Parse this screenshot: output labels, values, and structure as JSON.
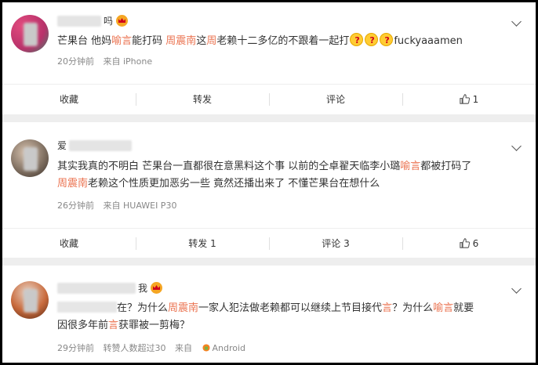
{
  "comments": [
    {
      "username_suffix": "吗",
      "content_segments": [
        {
          "text": "芒果台 他妈",
          "hl": false
        },
        {
          "text": "喻言",
          "hl": true
        },
        {
          "text": "能打码 ",
          "hl": false
        },
        {
          "text": "周震南",
          "hl": true
        },
        {
          "text": "这",
          "hl": false
        },
        {
          "text": "周",
          "hl": true
        },
        {
          "text": "老赖十二多亿的不跟着一起打",
          "hl": false
        }
      ],
      "content_tail": "fuckyaaamen",
      "emoji_count": 3,
      "time": "20分钟前",
      "source": "来自 iPhone",
      "actions": {
        "collect": "收藏",
        "forward": "转发",
        "comment": "评论",
        "like": "1"
      }
    },
    {
      "username_prefix": "爱",
      "line1_segments": [
        {
          "text": "其实我真的不明白 芒果台一直都很在意黑料这个事 以前的仝卓翟天临李小璐",
          "hl": false
        },
        {
          "text": "喻言",
          "hl": true
        },
        {
          "text": "都被打码了",
          "hl": false
        }
      ],
      "line2_segments": [
        {
          "text": "周震南",
          "hl": true
        },
        {
          "text": "老赖这个性质更加恶劣一些 竟然还播出来了 不懂芒果台在想什么",
          "hl": false
        }
      ],
      "time": "26分钟前",
      "source": "来自 HUAWEI P30",
      "actions": {
        "collect": "收藏",
        "forward": "转发 1",
        "comment": "评论 3",
        "like": "6"
      }
    },
    {
      "username_suffix": "我",
      "line1_prefix": "在？为什么",
      "line1_segments": [
        {
          "text": "周震南",
          "hl": true
        },
        {
          "text": "一家人犯法做老赖都可以继续上节目接代",
          "hl": false
        },
        {
          "text": "言",
          "hl": true
        },
        {
          "text": "？为什么",
          "hl": false
        },
        {
          "text": "喻言",
          "hl": true
        },
        {
          "text": "就要",
          "hl": false
        }
      ],
      "line2_segments": [
        {
          "text": "因很多年前",
          "hl": false
        },
        {
          "text": "言",
          "hl": true
        },
        {
          "text": "获罪被一剪梅？",
          "hl": false
        }
      ],
      "time": "29分钟前",
      "extra": "转赞人数超过30",
      "source_prefix": "来自",
      "source_app": "Android"
    }
  ],
  "colors": {
    "highlight": "#eb7350",
    "meta": "#888888",
    "text": "#333333"
  }
}
